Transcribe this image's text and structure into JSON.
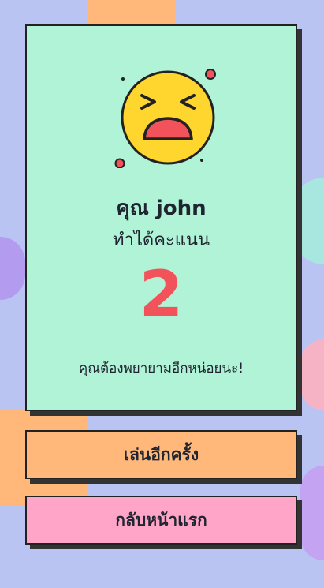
{
  "result": {
    "name_line": "คุณ john",
    "subtitle": "ทำได้คะแนน",
    "score": "2",
    "message": "คุณต้องพยายามอีกหน่อยนะ!",
    "emoji_icon": "tired-face-icon"
  },
  "buttons": {
    "replay_label": "เล่นอีกครั้ง",
    "home_label": "กลับหน้าแรก"
  },
  "colors": {
    "background": "#b9c4f2",
    "card": "#b0f3d6",
    "score": "#f2535b",
    "replay_button": "#ffb77a",
    "home_button": "#ffa6c8",
    "emoji_face": "#ffd62e"
  }
}
